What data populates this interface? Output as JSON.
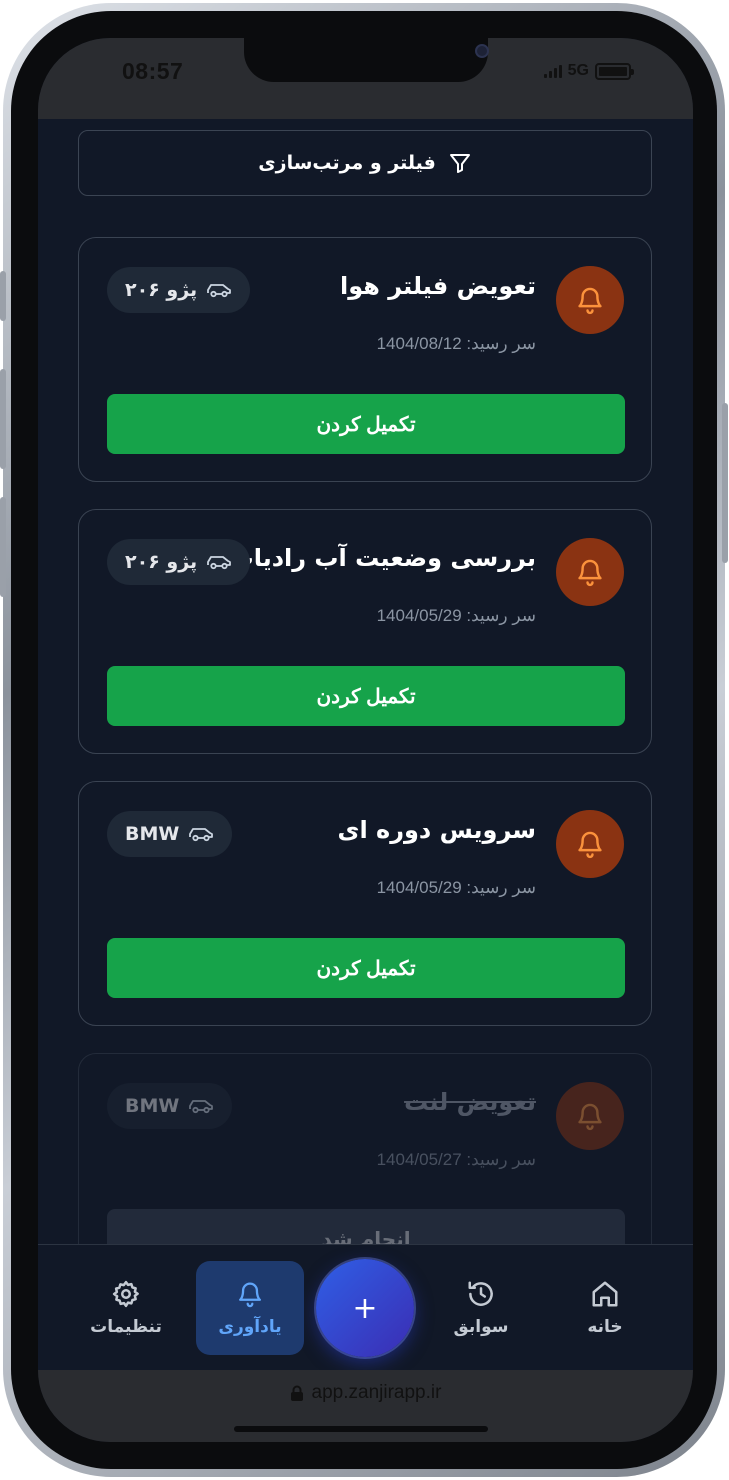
{
  "status_bar": {
    "time": "08:57",
    "network": "5G"
  },
  "filter": {
    "label": "فیلتر و مرتب‌سازی",
    "icon": "filter-icon"
  },
  "reminders": [
    {
      "title": "تعویض فیلتر هوا",
      "due": "سر رسید: 1404/08/12",
      "car": "پژو ۲۰۶",
      "action": "تکمیل کردن",
      "done": false
    },
    {
      "title": "بررسی وضعیت آب رادیات",
      "due": "سر رسید: 1404/05/29",
      "car": "پژو ۲۰۶",
      "action": "تکمیل کردن",
      "done": false
    },
    {
      "title": "سرویس دوره ای",
      "due": "سر رسید: 1404/05/29",
      "car": "BMW",
      "action": "تکمیل کردن",
      "done": false
    },
    {
      "title": "تعویض لنت",
      "due": "سر رسید: 1404/05/27",
      "car": "BMW",
      "action": "انجام شد",
      "done": true
    }
  ],
  "nav": {
    "home": "خانه",
    "history": "سوابق",
    "add": "+",
    "reminders": "یادآوری",
    "settings": "تنظیمات"
  },
  "browser": {
    "url": "app.zanjirapp.ir"
  },
  "colors": {
    "background": "#111827",
    "accent_green": "#16a34a",
    "bell_bg": "#8a3312",
    "bell_icon": "#fb923c",
    "active_nav": "#60a5fa"
  }
}
